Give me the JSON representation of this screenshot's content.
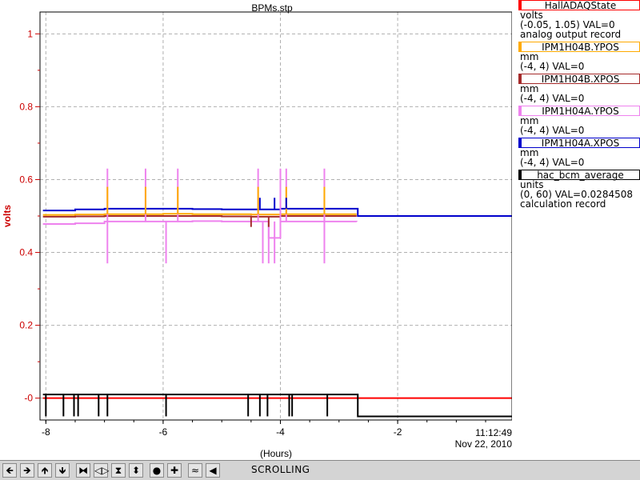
{
  "chart_data": {
    "type": "line",
    "title": "BPMs.stp",
    "xlabel": "(Hours)",
    "ylabel": "volts",
    "xlim": [
      -8.1,
      -0.05
    ],
    "ylim": [
      -0.06,
      1.06
    ],
    "x_ticks": [
      -8,
      -6,
      -4,
      -2
    ],
    "x_tick_labels": [
      "-8",
      "-6",
      "-4",
      "-2"
    ],
    "y_ticks": [
      0,
      0.2,
      0.4,
      0.6,
      0.8,
      1
    ],
    "y_tick_labels": [
      "-0",
      "0.2",
      "0.4",
      "0.6",
      "0.8",
      "1"
    ],
    "time_label": "11:12:49",
    "date_label": "Nov 22, 2010",
    "grid": true,
    "series": [
      {
        "name": "HallADAQState",
        "color": "#ff0000",
        "x": [
          -8.05,
          -0.05
        ],
        "y": [
          0.0,
          0.0
        ]
      },
      {
        "name": "IPM1H04B.YPOS",
        "color": "#ffaa00",
        "x": [
          -8.05,
          -7.5,
          -7.0,
          -6.5,
          -6.0,
          -5.5,
          -5.0,
          -4.5,
          -4.0,
          -3.5,
          -3.0,
          -2.7
        ],
        "y": [
          0.503,
          0.504,
          0.505,
          0.505,
          0.506,
          0.505,
          0.505,
          0.504,
          0.505,
          0.505,
          0.505,
          0.505
        ]
      },
      {
        "name": "IPM1H04B.XPOS",
        "color": "#a52a2a",
        "x": [
          -8.05,
          -7.5,
          -7.0,
          -6.5,
          -6.0,
          -5.5,
          -5.0,
          -4.5,
          -4.0,
          -3.5,
          -3.0,
          -2.7
        ],
        "y": [
          0.498,
          0.499,
          0.5,
          0.5,
          0.5,
          0.5,
          0.499,
          0.498,
          0.5,
          0.5,
          0.5,
          0.5
        ]
      },
      {
        "name": "IPM1H04A.YPOS",
        "color": "#ee82ee",
        "x": [
          -8.05,
          -7.5,
          -7.0,
          -6.5,
          -6.0,
          -5.5,
          -5.0,
          -4.5,
          -4.2,
          -4.0,
          -3.5,
          -3.0,
          -2.7
        ],
        "y": [
          0.478,
          0.48,
          0.485,
          0.485,
          0.485,
          0.486,
          0.485,
          0.485,
          0.44,
          0.485,
          0.485,
          0.485,
          0.484
        ]
      },
      {
        "name": "IPM1H04A.XPOS",
        "color": "#0000cc",
        "x": [
          -8.05,
          -7.5,
          -7.0,
          -6.5,
          -6.0,
          -5.5,
          -5.0,
          -4.5,
          -4.0,
          -3.5,
          -3.0,
          -2.7,
          -2.68,
          -0.05
        ],
        "y": [
          0.515,
          0.518,
          0.52,
          0.52,
          0.52,
          0.519,
          0.518,
          0.518,
          0.52,
          0.52,
          0.52,
          0.52,
          0.5,
          0.5
        ]
      },
      {
        "name": "hac_bcm_average",
        "color": "#000000",
        "x": [
          -8.05,
          -7.5,
          -7.0,
          -6.5,
          -6.0,
          -5.5,
          -5.0,
          -4.5,
          -4.0,
          -3.5,
          -3.0,
          -2.7,
          -2.68,
          -0.05
        ],
        "y": [
          0.01,
          0.01,
          0.01,
          0.01,
          0.01,
          0.01,
          0.01,
          0.01,
          0.01,
          0.01,
          0.01,
          0.01,
          -0.05,
          -0.05
        ]
      }
    ],
    "spikes": [
      {
        "series": "hac_bcm_average",
        "x": [
          -8.0,
          -7.7,
          -7.52,
          -7.45,
          -7.1,
          -6.95,
          -5.95,
          -4.55,
          -4.35,
          -4.22,
          -3.85,
          -3.8,
          -3.2
        ],
        "from": 0.01,
        "to": -0.05
      },
      {
        "series": "IPM1H04A.YPOS",
        "x": [
          -6.95,
          -5.95,
          -4.3,
          -4.2,
          -4.1,
          -3.25
        ],
        "from": 0.485,
        "to": 0.37
      },
      {
        "series": "IPM1H04A.YPOS",
        "x": [
          -6.95,
          -6.3,
          -5.75,
          -4.38,
          -4.0,
          -3.9,
          -3.25
        ],
        "from": 0.485,
        "to": 0.63
      },
      {
        "series": "IPM1H04B.YPOS",
        "x": [
          -6.95,
          -6.3,
          -5.75,
          -4.38,
          -3.9,
          -3.25
        ],
        "from": 0.505,
        "to": 0.58
      },
      {
        "series": "IPM1H04A.XPOS",
        "x": [
          -4.35,
          -4.1,
          -3.9
        ],
        "from": 0.52,
        "to": 0.55
      },
      {
        "series": "IPM1H04B.XPOS",
        "x": [
          -4.5,
          -4.2
        ],
        "from": 0.5,
        "to": 0.47
      }
    ]
  },
  "legend": {
    "entries": [
      {
        "name": "HallADAQState",
        "color": "#ff0000",
        "unit": "volts",
        "range": "(-0.05, 1.05) VAL=0",
        "extra": "analog output record"
      },
      {
        "name": "IPM1H04B.YPOS",
        "color": "#ffaa00",
        "unit": "mm",
        "range": "(-4, 4) VAL=0",
        "extra": ""
      },
      {
        "name": "IPM1H04B.XPOS",
        "color": "#a52a2a",
        "unit": "mm",
        "range": "(-4, 4) VAL=0",
        "extra": ""
      },
      {
        "name": "IPM1H04A.YPOS",
        "color": "#ee82ee",
        "unit": "mm",
        "range": "(-4, 4) VAL=0",
        "extra": ""
      },
      {
        "name": "IPM1H04A.XPOS",
        "color": "#0000cc",
        "unit": "mm",
        "range": "(-4, 4) VAL=0",
        "extra": ""
      },
      {
        "name": "hac_bcm_average",
        "color": "#000000",
        "unit": "units",
        "range": "(0, 60) VAL=0.0284508",
        "extra": "calculation record"
      }
    ]
  },
  "toolbar": {
    "buttons": [
      {
        "icon": "arrow-left-icon",
        "glyph": "🡸"
      },
      {
        "icon": "arrow-right-icon",
        "glyph": "🡺"
      },
      {
        "icon": "arrow-up-icon",
        "glyph": "🡹"
      },
      {
        "icon": "arrow-down-icon",
        "glyph": "🡻"
      },
      {
        "icon": "zoom-in-horizontal-icon",
        "glyph": "⧓"
      },
      {
        "icon": "zoom-out-horizontal-icon",
        "glyph": "◁▷"
      },
      {
        "icon": "zoom-in-vertical-icon",
        "glyph": "⧗"
      },
      {
        "icon": "zoom-out-vertical-icon",
        "glyph": "⬍"
      },
      {
        "icon": "reset-icon",
        "glyph": "●"
      },
      {
        "icon": "crosshair-icon",
        "glyph": "✚"
      },
      {
        "icon": "autoscale-icon",
        "glyph": "≈"
      },
      {
        "icon": "scroll-start-icon",
        "glyph": "◀"
      }
    ],
    "status": "SCROLLING"
  }
}
